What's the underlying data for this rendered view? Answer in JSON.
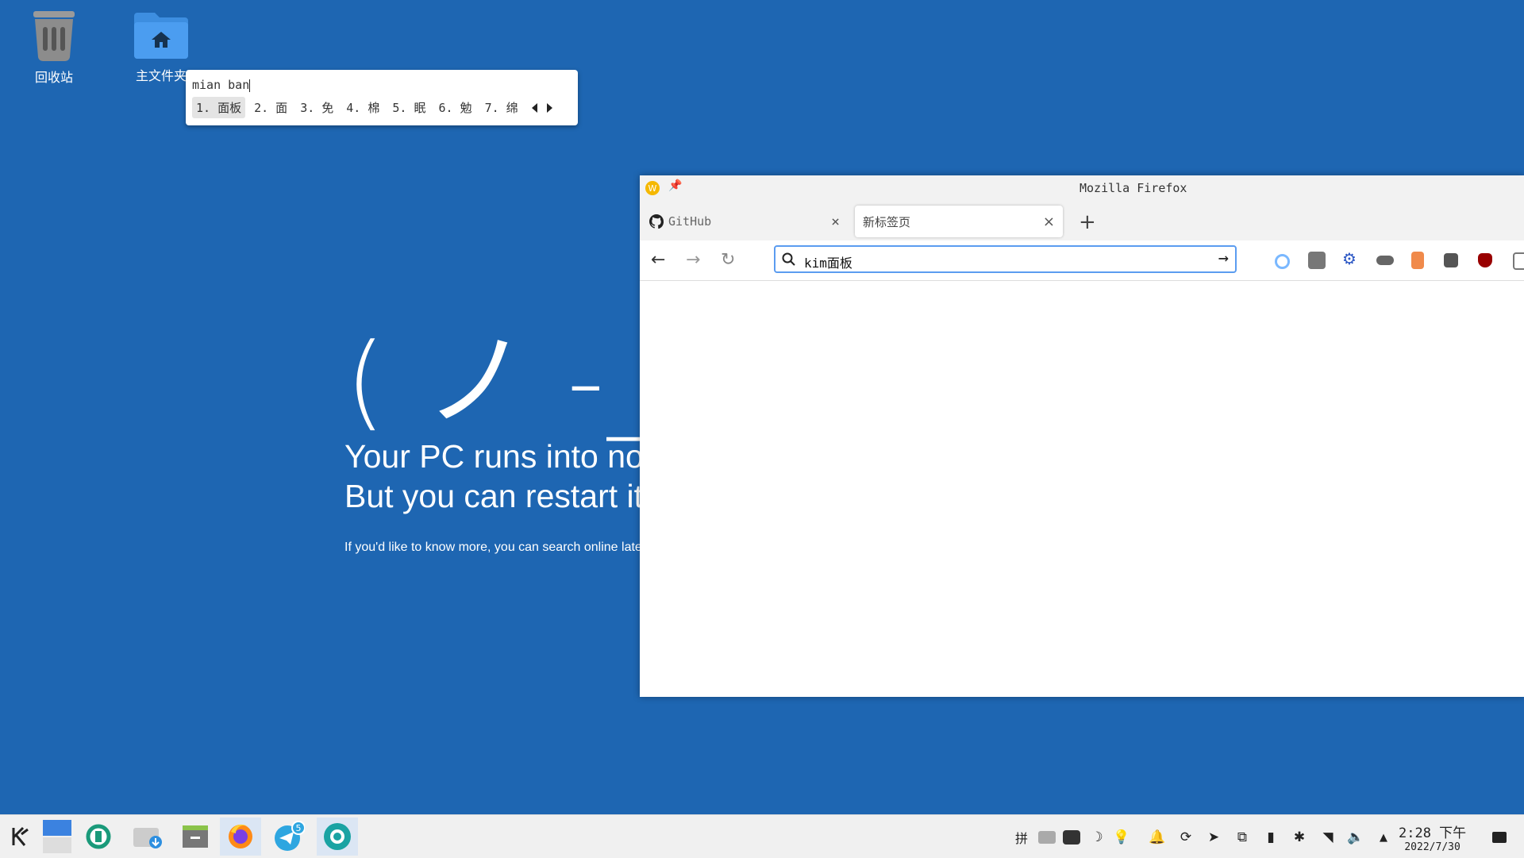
{
  "desktop": {
    "icons": [
      {
        "label": "回收站",
        "icon": "trash-icon"
      },
      {
        "label": "主文件夹",
        "icon": "home-folder-icon"
      }
    ]
  },
  "ime": {
    "preedit": "mian ban",
    "candidates": [
      "1. 面板",
      "2. 面",
      "3. 免",
      "4. 棉",
      "5. 眠",
      "6. 勉",
      "7. 绵"
    ]
  },
  "bsod": {
    "face": "( ノ -_-)",
    "line1": "Your PC runs into no",
    "line2": "But you can restart it",
    "small": "If you'd like to know more, you can search online later"
  },
  "firefox": {
    "title": "Mozilla Firefox",
    "tabs": [
      {
        "label": "GitHub",
        "icon": "github-icon",
        "active": false
      },
      {
        "label": "新标签页",
        "active": true
      }
    ],
    "urlbar_value": "kim面板",
    "extensions": [
      "circle-extension-icon",
      "ghost-extension-icon",
      "gear-extension-icon",
      "hat-extension-icon",
      "trash-extension-icon",
      "download-extension-icon",
      "ublock-origin-icon",
      "overflow-icon"
    ]
  },
  "taskbar": {
    "apps": [
      "kde-start-icon",
      "desktop-pager-icon",
      "software-center-icon",
      "downloads-icon",
      "file-manager-icon",
      "firefox-icon",
      "telegram-icon",
      "settings-icon"
    ],
    "telegram_badge": "5",
    "tray": [
      "拼",
      "chinese-icon",
      "chat-icon",
      "night-mode-icon",
      "bulb-icon",
      "bell-icon",
      "sync-icon",
      "telegram-tray-icon",
      "clipboard-icon",
      "battery-icon",
      "bluetooth-icon",
      "wifi-icon",
      "volume-icon",
      "expand-arrow-icon"
    ],
    "time": "2:28 下午",
    "date": "2022/7/30",
    "colors": {
      "desktop_bg": "#1e66b2",
      "accent": "#5b9cf0"
    }
  }
}
